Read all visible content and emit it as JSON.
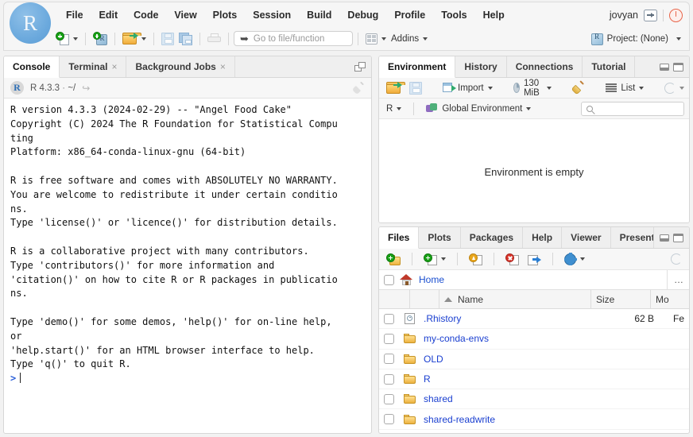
{
  "app": {
    "logo_letter": "R",
    "user": "jovyan"
  },
  "menubar": {
    "items": [
      {
        "label": "File"
      },
      {
        "label": "Edit"
      },
      {
        "label": "Code"
      },
      {
        "label": "View"
      },
      {
        "label": "Plots"
      },
      {
        "label": "Session"
      },
      {
        "label": "Build"
      },
      {
        "label": "Debug"
      },
      {
        "label": "Profile"
      },
      {
        "label": "Tools"
      },
      {
        "label": "Help"
      }
    ]
  },
  "toolbar": {
    "goto_placeholder": "Go to file/function",
    "addins_label": "Addins",
    "project_label": "Project: (None)"
  },
  "console": {
    "tabs": [
      {
        "label": "Console",
        "closable": false,
        "active": true
      },
      {
        "label": "Terminal",
        "closable": true,
        "active": false
      },
      {
        "label": "Background Jobs",
        "closable": true,
        "active": false
      }
    ],
    "close_glyph": "×",
    "version_label": "R 4.3.3",
    "separator": "·",
    "path": "~/",
    "goto_glyph": "↪",
    "output": "R version 4.3.3 (2024-02-29) -- \"Angel Food Cake\"\nCopyright (C) 2024 The R Foundation for Statistical Compu\nting\nPlatform: x86_64-conda-linux-gnu (64-bit)\n\nR is free software and comes with ABSOLUTELY NO WARRANTY.\nYou are welcome to redistribute it under certain conditio\nns.\nType 'license()' or 'licence()' for distribution details.\n\nR is a collaborative project with many contributors.\nType 'contributors()' for more information and\n'citation()' on how to cite R or R packages in publicatio\nns.\n\nType 'demo()' for some demos, 'help()' for on-line help,\nor\n'help.start()' for an HTML browser interface to help.\nType 'q()' to quit R.\n",
    "prompt": ">"
  },
  "environment": {
    "tabs": [
      {
        "label": "Environment",
        "active": true
      },
      {
        "label": "History",
        "active": false
      },
      {
        "label": "Connections",
        "active": false
      },
      {
        "label": "Tutorial",
        "active": false
      }
    ],
    "import_label": "Import",
    "memory_label": "130 MiB",
    "view_label": "List",
    "language_label": "R",
    "scope_label": "Global Environment",
    "search_placeholder": "",
    "empty_message": "Environment is empty"
  },
  "files": {
    "tabs": [
      {
        "label": "Files",
        "active": true
      },
      {
        "label": "Plots",
        "active": false
      },
      {
        "label": "Packages",
        "active": false
      },
      {
        "label": "Help",
        "active": false
      },
      {
        "label": "Viewer",
        "active": false
      },
      {
        "label": "Presenta",
        "active": false
      }
    ],
    "path_label": "Home",
    "more_glyph": "…",
    "columns": [
      "Name",
      "Size",
      "Mo"
    ],
    "rows": [
      {
        "name": ".Rhistory",
        "size": "62 B",
        "modified": "Fe",
        "icon": "history-file-icon"
      },
      {
        "name": "my-conda-envs",
        "size": "",
        "modified": "",
        "icon": "folder-icon"
      },
      {
        "name": "OLD",
        "size": "",
        "modified": "",
        "icon": "folder-icon"
      },
      {
        "name": "R",
        "size": "",
        "modified": "",
        "icon": "folder-icon"
      },
      {
        "name": "shared",
        "size": "",
        "modified": "",
        "icon": "folder-icon"
      },
      {
        "name": "shared-readwrite",
        "size": "",
        "modified": "",
        "icon": "folder-icon"
      }
    ]
  },
  "colors": {
    "accent_blue": "#6ba9dd",
    "link_blue": "#1a3fd0",
    "prompt_blue": "#2b5fd9",
    "power_red": "#e8654a",
    "folder_yellow": "#edb240",
    "panel_bg": "#ffffff",
    "chrome_bg": "#f2f2f2"
  }
}
